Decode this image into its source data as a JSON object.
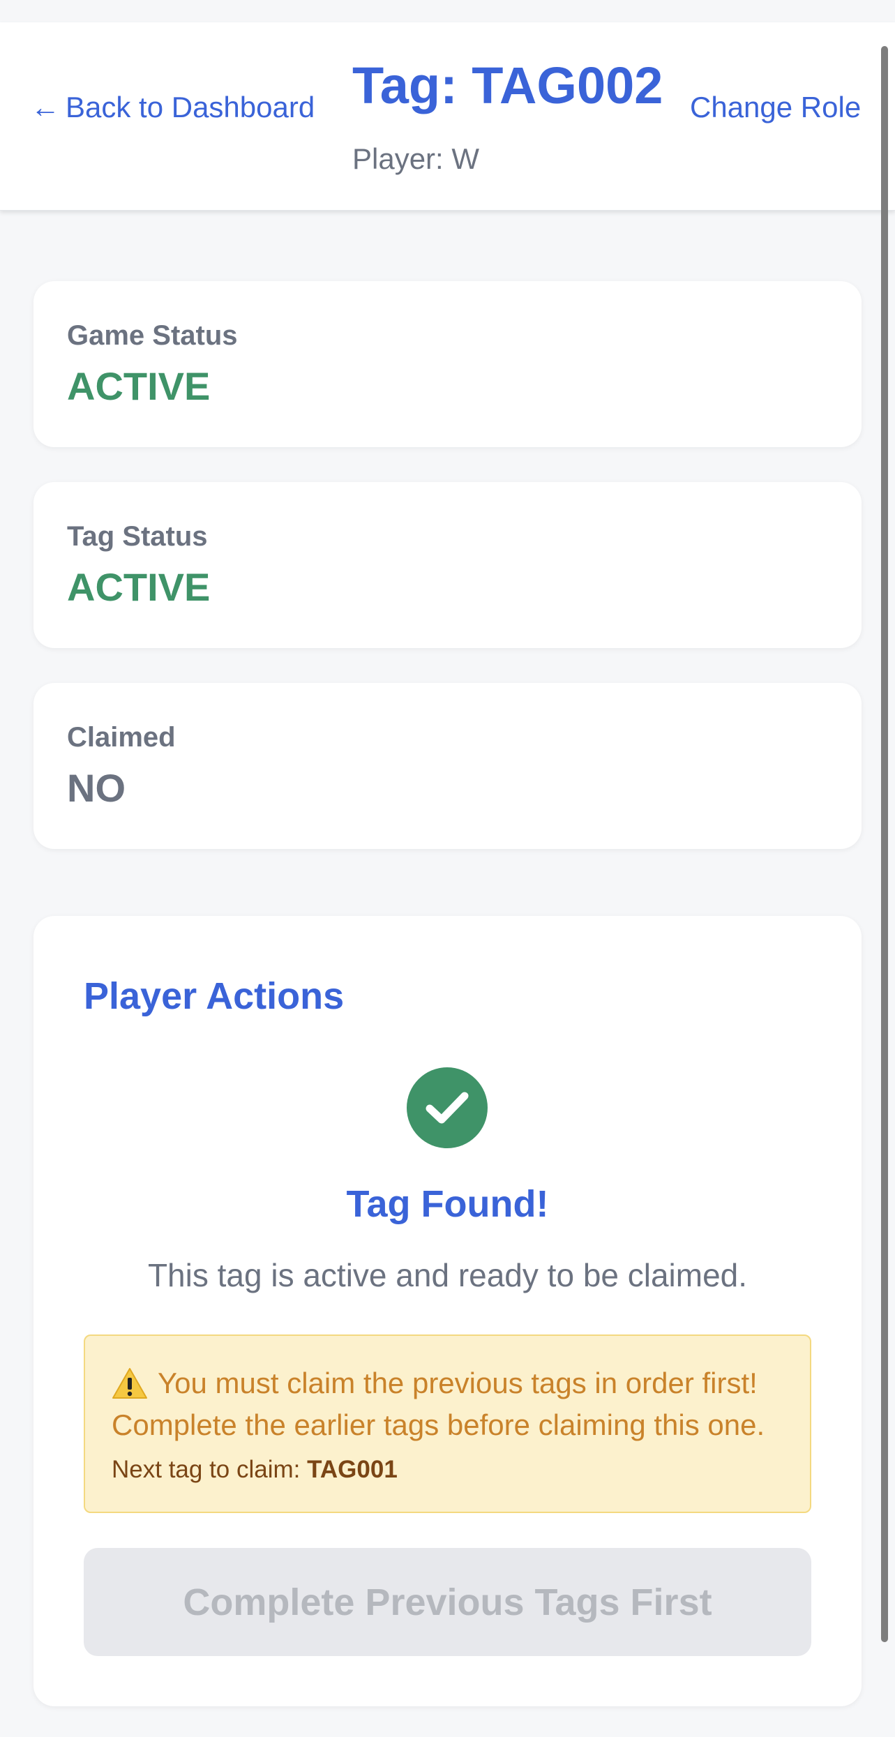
{
  "header": {
    "back_label": "Back to Dashboard",
    "back_arrow": "←",
    "title": "Tag: TAG002",
    "subtitle": "Player: W",
    "change_role_label": "Change Role"
  },
  "stats": [
    {
      "label": "Game Status",
      "value": "ACTIVE",
      "color": "#3f9368"
    },
    {
      "label": "Tag Status",
      "value": "ACTIVE",
      "color": "#3f9368"
    },
    {
      "label": "Claimed",
      "value": "NO",
      "color": "#6b7280"
    }
  ],
  "actions": {
    "title": "Player Actions",
    "icon": "check-circle-icon",
    "found_title": "Tag Found!",
    "found_desc": "This tag is active and ready to be claimed.",
    "warning": {
      "icon": "warning-icon",
      "line1": "You must claim the previous tags in order first!",
      "line2": "Complete the earlier tags before claiming this one.",
      "next_prefix": "Next tag to claim:",
      "next_tag": "TAG001"
    },
    "button_label": "Complete Previous Tags First"
  },
  "colors": {
    "accent": "#3a63d8",
    "success": "#3f9368",
    "warning_bg": "#fcf1cd",
    "warning_text": "#c9822a"
  }
}
